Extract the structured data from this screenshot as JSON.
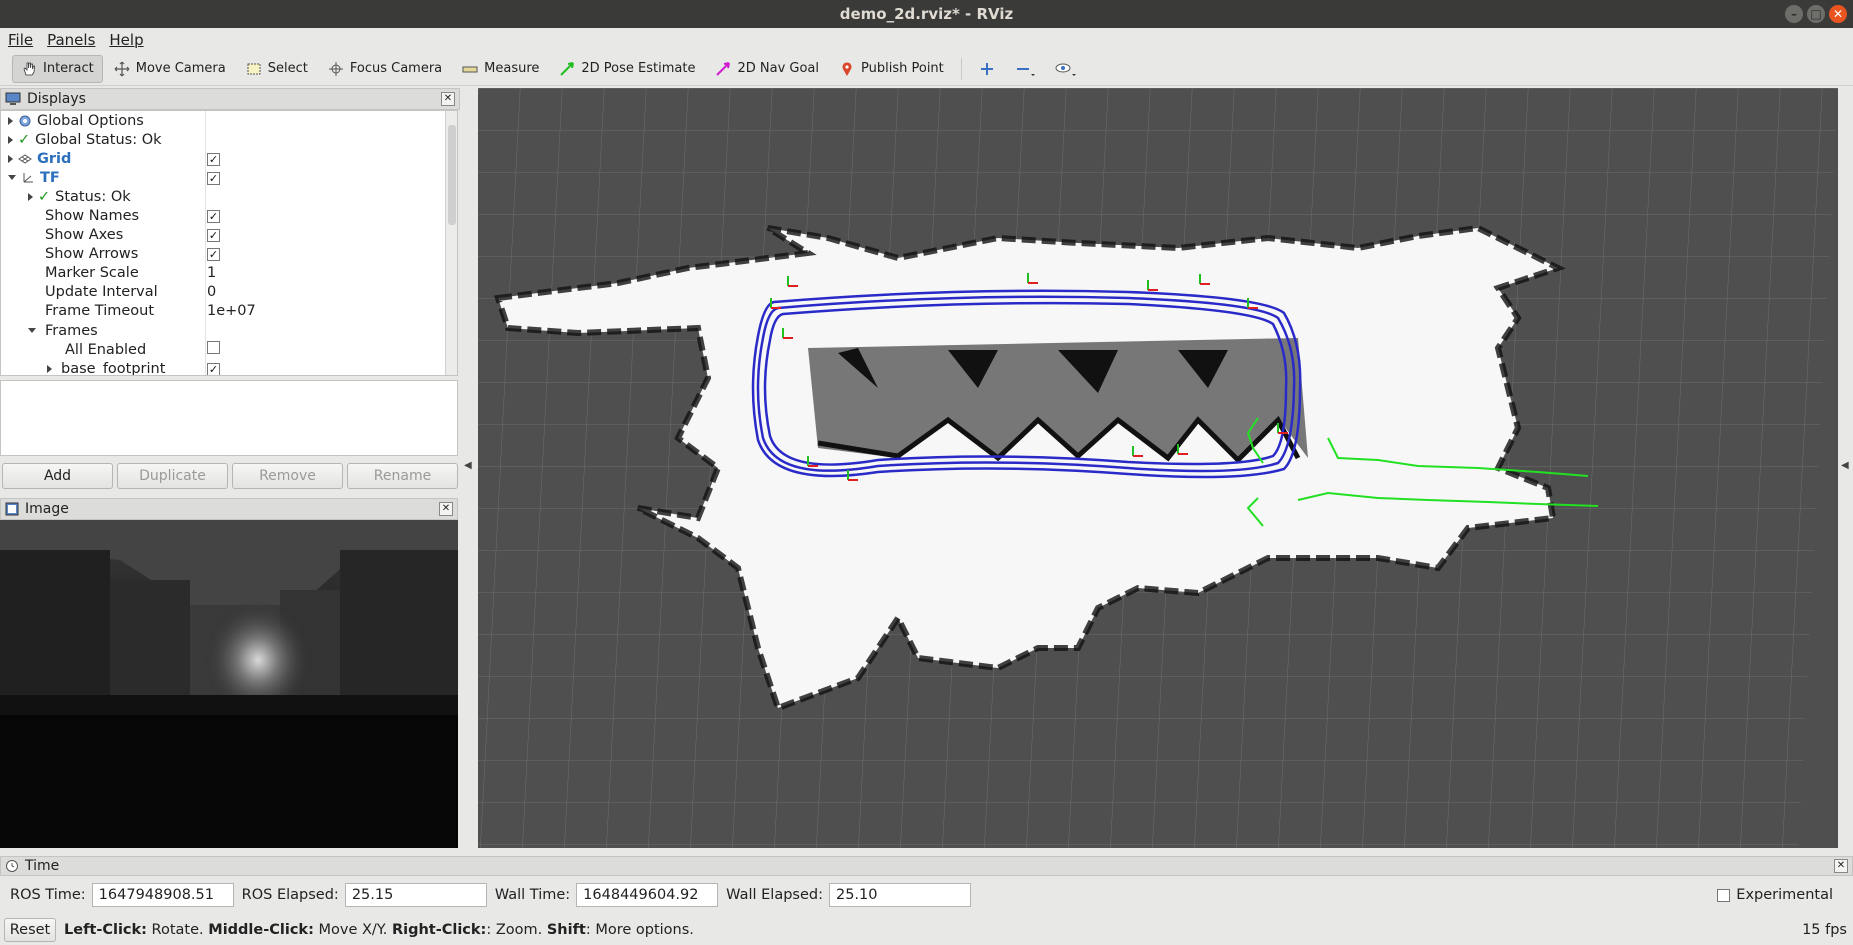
{
  "window": {
    "title": "demo_2d.rviz* - RViz"
  },
  "menu": {
    "file": "File",
    "panels": "Panels",
    "help": "Help"
  },
  "toolbar": {
    "interact": "Interact",
    "move_camera": "Move Camera",
    "select": "Select",
    "focus_camera": "Focus Camera",
    "measure": "Measure",
    "pose_estimate": "2D Pose Estimate",
    "nav_goal": "2D Nav Goal",
    "publish_point": "Publish Point"
  },
  "displays": {
    "title": "Displays",
    "rows": [
      {
        "name": "Global Options",
        "value": ""
      },
      {
        "name": "Global Status: Ok",
        "value": ""
      },
      {
        "name": "Grid",
        "value": ""
      },
      {
        "name": "TF",
        "value": ""
      },
      {
        "name": "Status: Ok",
        "value": ""
      },
      {
        "name": "Show Names",
        "value": ""
      },
      {
        "name": "Show Axes",
        "value": ""
      },
      {
        "name": "Show Arrows",
        "value": ""
      },
      {
        "name": "Marker Scale",
        "value": "1"
      },
      {
        "name": "Update Interval",
        "value": "0"
      },
      {
        "name": "Frame Timeout",
        "value": "1e+07"
      },
      {
        "name": "Frames",
        "value": ""
      },
      {
        "name": "All Enabled",
        "value": ""
      },
      {
        "name": "base_footprint",
        "value": ""
      }
    ],
    "buttons": {
      "add": "Add",
      "duplicate": "Duplicate",
      "remove": "Remove",
      "rename": "Rename"
    }
  },
  "image_panel": {
    "title": "Image"
  },
  "time_panel": {
    "title": "Time",
    "ros_time_label": "ROS Time:",
    "ros_time": "1647948908.51",
    "ros_elapsed_label": "ROS Elapsed:",
    "ros_elapsed": "25.15",
    "wall_time_label": "Wall Time:",
    "wall_time": "1648449604.92",
    "wall_elapsed_label": "Wall Elapsed:",
    "wall_elapsed": "25.10",
    "experimental": "Experimental"
  },
  "status": {
    "reset": "Reset",
    "left_click": "Left-Click:",
    "left_click_desc": " Rotate. ",
    "middle_click": "Middle-Click:",
    "middle_click_desc": " Move X/Y. ",
    "right_click": "Right-Click:",
    "right_click_desc": ": Zoom. ",
    "shift": "Shift",
    "shift_desc": ": More options.",
    "fps": "15 fps"
  },
  "colors": {
    "map_background": "#4f4f4f",
    "trajectory": "#2a2ac8",
    "path": "#22e022",
    "titlebar": "#3a3a38",
    "accent": "#e95420"
  }
}
